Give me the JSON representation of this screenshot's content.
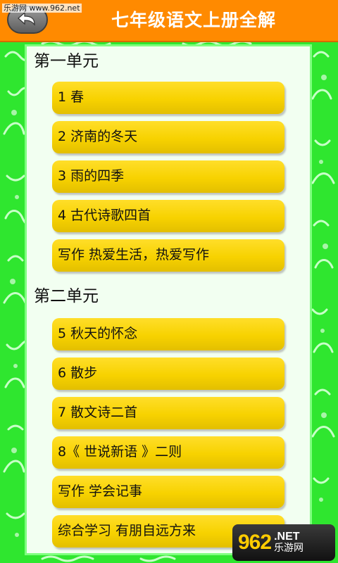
{
  "app": {
    "title": "七年级语文上册全解",
    "back_icon": "back-arrow-icon",
    "watermark": "乐游网 www.962.net"
  },
  "colors": {
    "appbar": "#ff8a00",
    "frame": "#2fe62f",
    "panel": "#f2fff1",
    "lesson_button": "#f7d200"
  },
  "units": [
    {
      "title": "第一单元",
      "lessons": [
        "1 春",
        "2 济南的冬天",
        "3 雨的四季",
        "4 古代诗歌四首",
        "写作 热爱生活，热爱写作"
      ]
    },
    {
      "title": "第二单元",
      "lessons": [
        "5 秋天的怀念",
        "6 散步",
        "7 散文诗二首",
        "8《 世说新语 》二则",
        "写作 学会记事",
        "综合学习 有朋自远方来"
      ]
    }
  ],
  "logo": {
    "number": "962",
    "domain": ".NET",
    "name": "乐游网"
  }
}
